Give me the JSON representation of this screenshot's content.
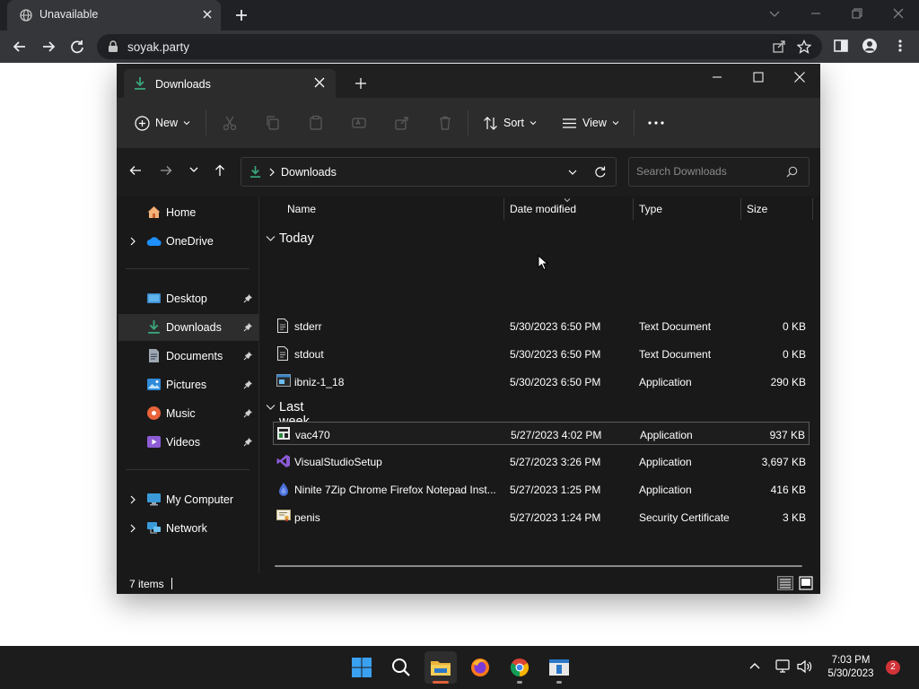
{
  "browser": {
    "tab": {
      "title": "Unavailable"
    },
    "address_bar": {
      "url": "soyak.party"
    }
  },
  "explorer": {
    "tab": {
      "title": "Downloads"
    },
    "command_bar": {
      "new_label": "New",
      "sort_label": "Sort",
      "view_label": "View"
    },
    "address": {
      "path": "Downloads"
    },
    "search": {
      "placeholder": "Search Downloads"
    },
    "nav": {
      "items": [
        {
          "label": "Home"
        },
        {
          "label": "OneDrive"
        },
        {
          "label": "Desktop"
        },
        {
          "label": "Downloads"
        },
        {
          "label": "Documents"
        },
        {
          "label": "Pictures"
        },
        {
          "label": "Music"
        },
        {
          "label": "Videos"
        },
        {
          "label": "My Computer"
        },
        {
          "label": "Network"
        }
      ]
    },
    "columns": {
      "name": "Name",
      "date": "Date modified",
      "type": "Type",
      "size": "Size"
    },
    "groups": [
      {
        "label": "Today",
        "files": [
          {
            "name": "stderr",
            "date": "5/30/2023 6:50 PM",
            "type": "Text Document",
            "size": "0 KB"
          },
          {
            "name": "stdout",
            "date": "5/30/2023 6:50 PM",
            "type": "Text Document",
            "size": "0 KB"
          },
          {
            "name": "ibniz-1_18",
            "date": "5/30/2023 6:50 PM",
            "type": "Application",
            "size": "290 KB"
          }
        ]
      },
      {
        "label": "Last week",
        "files": [
          {
            "name": "vac470",
            "date": "5/27/2023 4:02 PM",
            "type": "Application",
            "size": "937 KB"
          },
          {
            "name": "VisualStudioSetup",
            "date": "5/27/2023 3:26 PM",
            "type": "Application",
            "size": "3,697 KB"
          },
          {
            "name": "Ninite 7Zip Chrome Firefox Notepad Inst...",
            "date": "5/27/2023 1:25 PM",
            "type": "Application",
            "size": "416 KB"
          },
          {
            "name": "penis",
            "date": "5/27/2023 1:24 PM",
            "type": "Security Certificate",
            "size": "3 KB"
          }
        ]
      }
    ],
    "status": {
      "item_count": "7 items"
    }
  },
  "taskbar": {
    "clock": {
      "time": "7:03 PM",
      "date": "5/30/2023"
    },
    "notification_count": "2"
  },
  "colors": {
    "explorer_bg": "#191919",
    "command_bar": "#2c2c2c",
    "downloads_green": "#3aa57a",
    "taskbar_bg": "#1c1c1c",
    "badge_red": "#d13438"
  }
}
